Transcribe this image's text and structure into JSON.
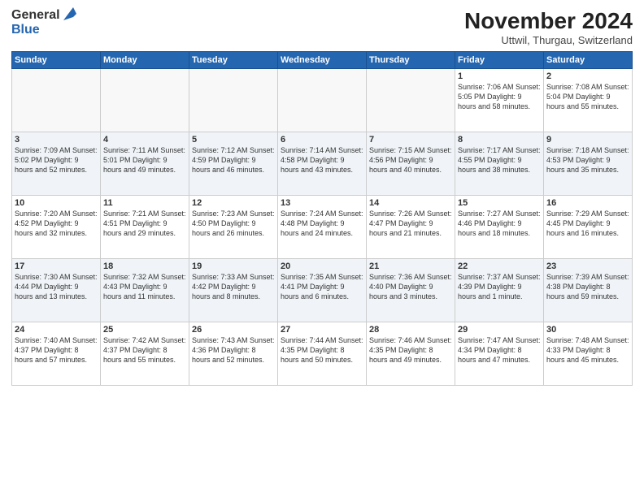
{
  "logo": {
    "line1": "General",
    "line2": "Blue"
  },
  "title": "November 2024",
  "location": "Uttwil, Thurgau, Switzerland",
  "weekdays": [
    "Sunday",
    "Monday",
    "Tuesday",
    "Wednesday",
    "Thursday",
    "Friday",
    "Saturday"
  ],
  "weeks": [
    [
      {
        "day": "",
        "info": ""
      },
      {
        "day": "",
        "info": ""
      },
      {
        "day": "",
        "info": ""
      },
      {
        "day": "",
        "info": ""
      },
      {
        "day": "",
        "info": ""
      },
      {
        "day": "1",
        "info": "Sunrise: 7:06 AM\nSunset: 5:05 PM\nDaylight: 9 hours\nand 58 minutes."
      },
      {
        "day": "2",
        "info": "Sunrise: 7:08 AM\nSunset: 5:04 PM\nDaylight: 9 hours\nand 55 minutes."
      }
    ],
    [
      {
        "day": "3",
        "info": "Sunrise: 7:09 AM\nSunset: 5:02 PM\nDaylight: 9 hours\nand 52 minutes."
      },
      {
        "day": "4",
        "info": "Sunrise: 7:11 AM\nSunset: 5:01 PM\nDaylight: 9 hours\nand 49 minutes."
      },
      {
        "day": "5",
        "info": "Sunrise: 7:12 AM\nSunset: 4:59 PM\nDaylight: 9 hours\nand 46 minutes."
      },
      {
        "day": "6",
        "info": "Sunrise: 7:14 AM\nSunset: 4:58 PM\nDaylight: 9 hours\nand 43 minutes."
      },
      {
        "day": "7",
        "info": "Sunrise: 7:15 AM\nSunset: 4:56 PM\nDaylight: 9 hours\nand 40 minutes."
      },
      {
        "day": "8",
        "info": "Sunrise: 7:17 AM\nSunset: 4:55 PM\nDaylight: 9 hours\nand 38 minutes."
      },
      {
        "day": "9",
        "info": "Sunrise: 7:18 AM\nSunset: 4:53 PM\nDaylight: 9 hours\nand 35 minutes."
      }
    ],
    [
      {
        "day": "10",
        "info": "Sunrise: 7:20 AM\nSunset: 4:52 PM\nDaylight: 9 hours\nand 32 minutes."
      },
      {
        "day": "11",
        "info": "Sunrise: 7:21 AM\nSunset: 4:51 PM\nDaylight: 9 hours\nand 29 minutes."
      },
      {
        "day": "12",
        "info": "Sunrise: 7:23 AM\nSunset: 4:50 PM\nDaylight: 9 hours\nand 26 minutes."
      },
      {
        "day": "13",
        "info": "Sunrise: 7:24 AM\nSunset: 4:48 PM\nDaylight: 9 hours\nand 24 minutes."
      },
      {
        "day": "14",
        "info": "Sunrise: 7:26 AM\nSunset: 4:47 PM\nDaylight: 9 hours\nand 21 minutes."
      },
      {
        "day": "15",
        "info": "Sunrise: 7:27 AM\nSunset: 4:46 PM\nDaylight: 9 hours\nand 18 minutes."
      },
      {
        "day": "16",
        "info": "Sunrise: 7:29 AM\nSunset: 4:45 PM\nDaylight: 9 hours\nand 16 minutes."
      }
    ],
    [
      {
        "day": "17",
        "info": "Sunrise: 7:30 AM\nSunset: 4:44 PM\nDaylight: 9 hours\nand 13 minutes."
      },
      {
        "day": "18",
        "info": "Sunrise: 7:32 AM\nSunset: 4:43 PM\nDaylight: 9 hours\nand 11 minutes."
      },
      {
        "day": "19",
        "info": "Sunrise: 7:33 AM\nSunset: 4:42 PM\nDaylight: 9 hours\nand 8 minutes."
      },
      {
        "day": "20",
        "info": "Sunrise: 7:35 AM\nSunset: 4:41 PM\nDaylight: 9 hours\nand 6 minutes."
      },
      {
        "day": "21",
        "info": "Sunrise: 7:36 AM\nSunset: 4:40 PM\nDaylight: 9 hours\nand 3 minutes."
      },
      {
        "day": "22",
        "info": "Sunrise: 7:37 AM\nSunset: 4:39 PM\nDaylight: 9 hours\nand 1 minute."
      },
      {
        "day": "23",
        "info": "Sunrise: 7:39 AM\nSunset: 4:38 PM\nDaylight: 8 hours\nand 59 minutes."
      }
    ],
    [
      {
        "day": "24",
        "info": "Sunrise: 7:40 AM\nSunset: 4:37 PM\nDaylight: 8 hours\nand 57 minutes."
      },
      {
        "day": "25",
        "info": "Sunrise: 7:42 AM\nSunset: 4:37 PM\nDaylight: 8 hours\nand 55 minutes."
      },
      {
        "day": "26",
        "info": "Sunrise: 7:43 AM\nSunset: 4:36 PM\nDaylight: 8 hours\nand 52 minutes."
      },
      {
        "day": "27",
        "info": "Sunrise: 7:44 AM\nSunset: 4:35 PM\nDaylight: 8 hours\nand 50 minutes."
      },
      {
        "day": "28",
        "info": "Sunrise: 7:46 AM\nSunset: 4:35 PM\nDaylight: 8 hours\nand 49 minutes."
      },
      {
        "day": "29",
        "info": "Sunrise: 7:47 AM\nSunset: 4:34 PM\nDaylight: 8 hours\nand 47 minutes."
      },
      {
        "day": "30",
        "info": "Sunrise: 7:48 AM\nSunset: 4:33 PM\nDaylight: 8 hours\nand 45 minutes."
      }
    ]
  ]
}
